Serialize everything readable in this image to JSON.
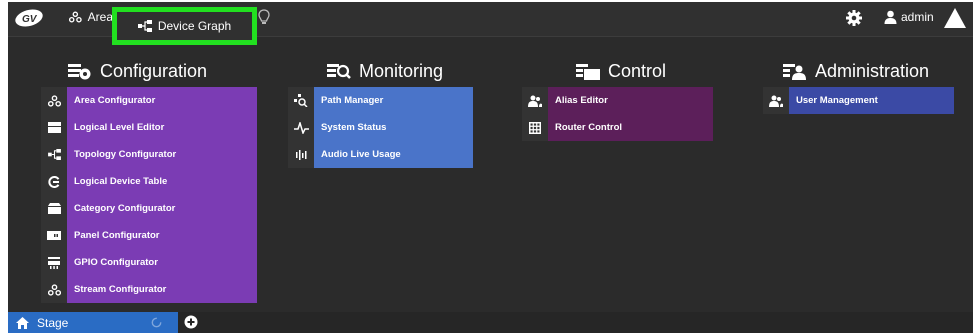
{
  "topbar": {
    "area_label": "Area",
    "device_graph_label": "Device Graph",
    "user_label": "admin"
  },
  "columns": {
    "configuration": {
      "title": "Configuration",
      "items": [
        {
          "label": "Area Configurator",
          "icon": "area-icon"
        },
        {
          "label": "Logical Level Editor",
          "icon": "level-icon"
        },
        {
          "label": "Topology Configurator",
          "icon": "topology-icon"
        },
        {
          "label": "Logical Device Table",
          "icon": "device-table-icon"
        },
        {
          "label": "Category Configurator",
          "icon": "category-icon"
        },
        {
          "label": "Panel Configurator",
          "icon": "panel-icon"
        },
        {
          "label": "GPIO Configurator",
          "icon": "gpio-icon"
        },
        {
          "label": "Stream Configurator",
          "icon": "stream-icon"
        }
      ]
    },
    "monitoring": {
      "title": "Monitoring",
      "items": [
        {
          "label": "Path Manager",
          "icon": "path-icon"
        },
        {
          "label": "System Status",
          "icon": "pulse-icon"
        },
        {
          "label": "Audio Live Usage",
          "icon": "audio-icon"
        }
      ]
    },
    "control": {
      "title": "Control",
      "items": [
        {
          "label": "Alias Editor",
          "icon": "alias-icon"
        },
        {
          "label": "Router Control",
          "icon": "grid-icon"
        }
      ]
    },
    "administration": {
      "title": "Administration",
      "items": [
        {
          "label": "User Management",
          "icon": "users-icon"
        }
      ]
    }
  },
  "bottombar": {
    "stage_label": "Stage"
  },
  "colors": {
    "highlight": "#22e020",
    "configuration": "#7b3cb4",
    "monitoring": "#4a74c9",
    "control": "#5c1f5a",
    "administration": "#3b4aa5",
    "stage_tab": "#2a6cc4"
  }
}
